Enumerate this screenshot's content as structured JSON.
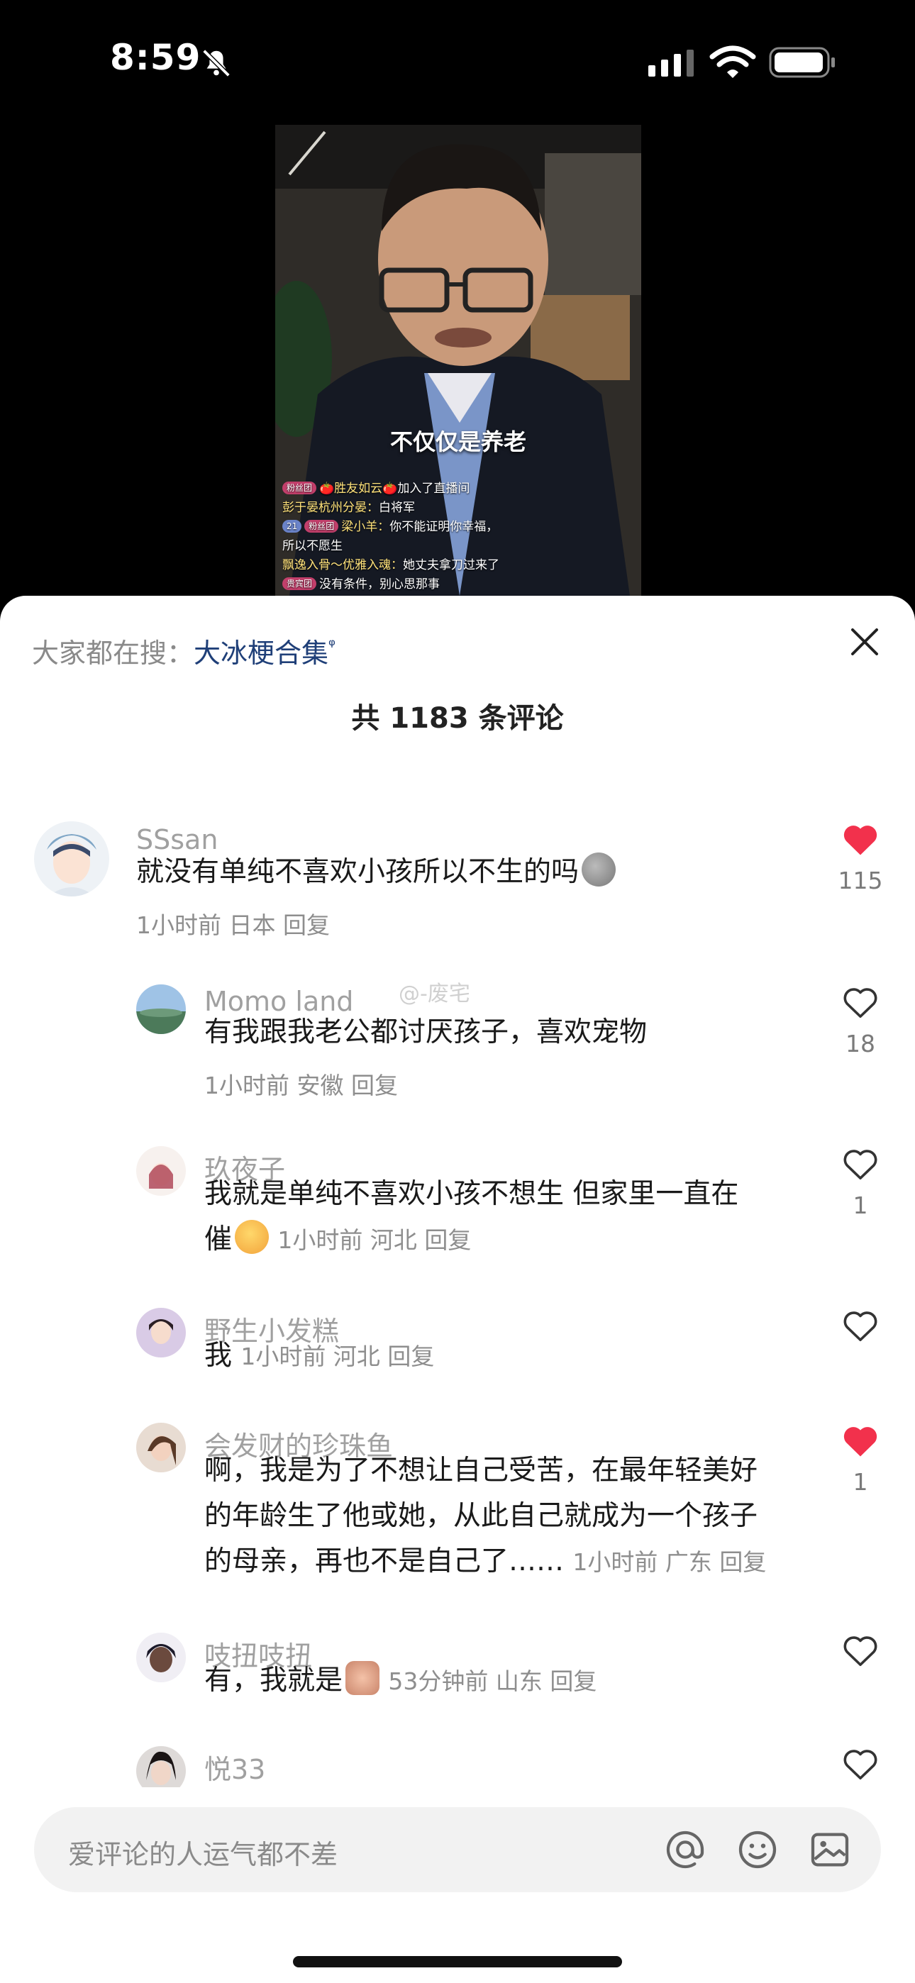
{
  "status_bar": {
    "time": "8:59"
  },
  "video": {
    "caption": "不仅仅是养老",
    "chat": [
      {
        "badge": "粉丝团",
        "name": "🍅胜友如云🍅",
        "text": "加入了直播间"
      },
      {
        "badge": "",
        "name": "彭于晏杭州分晏：",
        "text": "白将军"
      },
      {
        "badge": "21",
        "badge2": "粉丝团",
        "name": "梁小羊：",
        "text": "你不能证明你幸福，"
      },
      {
        "badge": "",
        "name": "",
        "text": "所以不愿生"
      },
      {
        "badge": "",
        "name": "飘逸入骨～优雅入魂：",
        "text": "她丈夫拿刀过来了"
      },
      {
        "badge": "贵宾团",
        "name": "",
        "text": "没有条件，别心思那事"
      }
    ]
  },
  "sheet": {
    "search_prefix": "大家都在搜：",
    "search_keyword": "大冰梗合集",
    "comment_count_label": "共 1183 条评论",
    "watermark": "@-废宅",
    "input_placeholder": "爱评论的人运气都不差"
  },
  "comments": [
    {
      "name": "SSsan",
      "text": "就没有单纯不喜欢小孩所以不生的吗",
      "meta": "1小时前 日本 回复",
      "likes": "115",
      "liked": true
    },
    {
      "name": "Momo land",
      "text": "有我跟我老公都讨厌孩子，喜欢宠物",
      "meta": "1小时前 安徽 回复",
      "likes": "18",
      "liked": false
    },
    {
      "name": "玖夜子",
      "text_line1": "我就是单纯不喜欢小孩不想生  但家里一直在",
      "text_line2": "催",
      "meta": "1小时前 河北 回复",
      "likes": "1",
      "liked": false
    },
    {
      "name": "野生小发糕",
      "text": "我",
      "meta": "1小时前 河北 回复",
      "likes": "",
      "liked": false
    },
    {
      "name": "会发财的珍珠鱼",
      "text_line1": "啊，我是为了不想让自己受苦，在最年轻美好",
      "text_line2": "的年龄生了他或她，从此自己就成为一个孩子",
      "text_line3": "的母亲，再也不是自己了……",
      "meta": "1小时前 广东 回复",
      "likes": "1",
      "liked": true
    },
    {
      "name": "吱扭吱扭",
      "text": "有，我就是",
      "meta": "53分钟前 山东 回复",
      "likes": "",
      "liked": false
    },
    {
      "name": "悦33",
      "text": "",
      "meta": "",
      "likes": "",
      "liked": false
    }
  ],
  "colors": {
    "like_red": "#f2314c",
    "keyword_blue": "#1f3f78"
  }
}
